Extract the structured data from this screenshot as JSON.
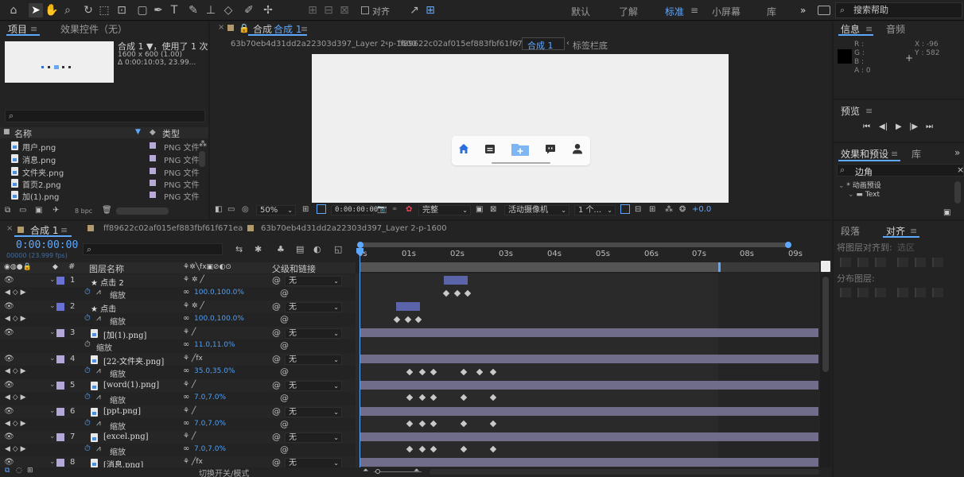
{
  "workspaces": [
    {
      "label": "默认",
      "active": false
    },
    {
      "label": "了解",
      "active": false
    },
    {
      "label": "标准",
      "active": true
    },
    {
      "label": "小屏幕",
      "active": false
    },
    {
      "label": "库",
      "active": false
    }
  ],
  "toolbar": {
    "align_checkbox_label": "对齐",
    "search_placeholder": "搜索帮助",
    "more_label": "»"
  },
  "project_panel": {
    "tab_project": "项目",
    "tab_effects": "效果控件（无）",
    "comp_name": "合成 1 ▼，使用了 1 次",
    "comp_size": "1600 x 600 (1.00)",
    "comp_duration": "Δ 0:00:10:03, 23.99...",
    "search_placeholder": "",
    "col_name": "名称",
    "col_type": "类型",
    "items": [
      {
        "name": "用户.png",
        "type": "PNG 文件"
      },
      {
        "name": "消息.png",
        "type": "PNG 文件"
      },
      {
        "name": "文件夹.png",
        "type": "PNG 文件"
      },
      {
        "name": "首页2.png",
        "type": "PNG 文件"
      },
      {
        "name": "加(1).png",
        "type": "PNG 文件"
      }
    ],
    "bpc_label": "8 bpc"
  },
  "viewer": {
    "tab_label": "合成",
    "tab_comp": "合成 1",
    "breadcrumbs": [
      "63b70eb4d31dd2a22303d397_Layer 2-p-1600",
      "ff89622c02af015ef883fbf61f671ea",
      "合成 1",
      "标签栏底"
    ],
    "zoom": "50%",
    "timecode": "0:00:00:00",
    "resolution": "完整",
    "camera": "活动摄像机",
    "view_count": "1 个...",
    "exposure": "+0.0"
  },
  "info_panel": {
    "tab_info": "信息",
    "tab_audio": "音频",
    "r": "R :",
    "g": "G :",
    "b": "B :",
    "a": "A : 0",
    "x": "X : -96",
    "y": "Y : 582"
  },
  "preview_panel": {
    "tab": "预览"
  },
  "effects_panel": {
    "tab_effects": "效果和预设",
    "tab_lib": "库",
    "search_value": "边角",
    "tree": [
      "* 动画预设",
      "Text"
    ]
  },
  "paragraph_panel": {
    "tab_paragraph": "段落",
    "tab_align": "对齐",
    "align_to_label": "将图层对齐到:",
    "align_to_value": "选区",
    "distribute_label": "分布图层:"
  },
  "timeline": {
    "tab_comp": "合成 1",
    "tab2": "ff89622c02af015ef883fbf61f671ea",
    "tab3": "63b70eb4d31dd2a22303d397_Layer 2-p-1600",
    "timecode": "0:00:00:00",
    "frame_info": "00000 (23.999 fps)",
    "col_layer_name": "图层名称",
    "col_parent": "父级和链接",
    "col_num": "#",
    "toggle_label": "切换开关/模式",
    "ruler": [
      "0s",
      "01s",
      "02s",
      "03s",
      "04s",
      "05s",
      "06s",
      "07s",
      "08s",
      "09s"
    ],
    "layers": [
      {
        "num": "1",
        "name": "★ 点击 2",
        "parent": "无",
        "color": "#6a72d6",
        "sub": "缩放",
        "value": "100.0,100.0%"
      },
      {
        "num": "2",
        "name": "★ 点击",
        "parent": "无",
        "color": "#6a72d6",
        "sub": "缩放",
        "value": "100.0,100.0%"
      },
      {
        "num": "3",
        "name": "[加(1).png]",
        "parent": "无",
        "color": "#b3a8d9",
        "sub": "缩放",
        "value": "11.0,11.0%"
      },
      {
        "num": "4",
        "name": "[22-文件夹.png]",
        "parent": "无",
        "color": "#b3a8d9",
        "sub": "缩放",
        "value": "35.0,35.0%"
      },
      {
        "num": "5",
        "name": "[word(1).png]",
        "parent": "无",
        "color": "#b3a8d9",
        "sub": "缩放",
        "value": "7.0,7.0%"
      },
      {
        "num": "6",
        "name": "[ppt.png]",
        "parent": "无",
        "color": "#b3a8d9",
        "sub": "缩放",
        "value": "7.0,7.0%"
      },
      {
        "num": "7",
        "name": "[excel.png]",
        "parent": "无",
        "color": "#b3a8d9",
        "sub": "缩放",
        "value": "7.0,7.0%"
      },
      {
        "num": "8",
        "name": "[消息.png]",
        "parent": "无",
        "color": "#b3a8d9"
      }
    ]
  }
}
